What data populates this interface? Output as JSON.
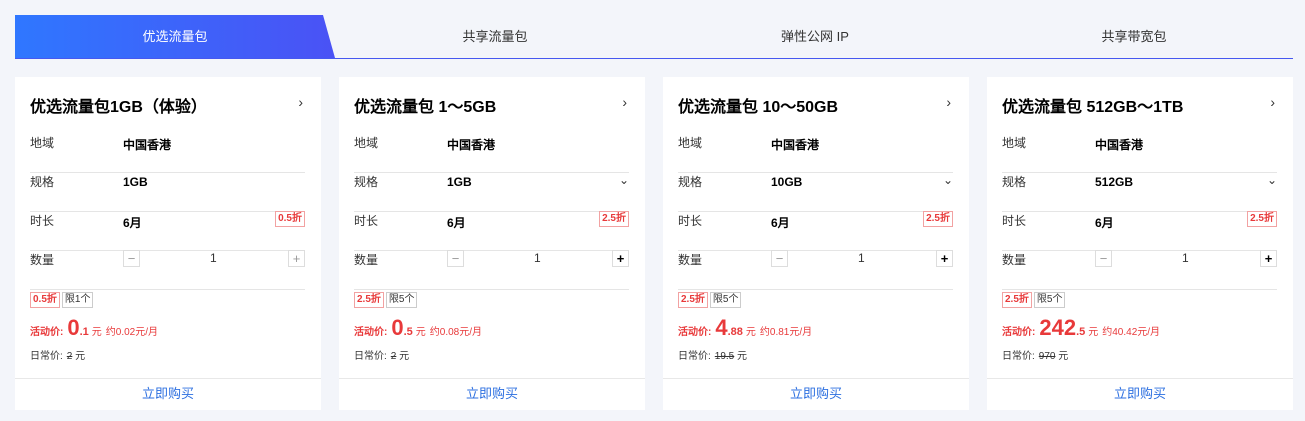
{
  "tabs": [
    {
      "label": "优选流量包",
      "active": true
    },
    {
      "label": "共享流量包",
      "active": false
    },
    {
      "label": "弹性公网 IP",
      "active": false
    },
    {
      "label": "共享带宽包",
      "active": false
    }
  ],
  "colors": {
    "accent": "#2f77ff",
    "accent_end": "#4a52f5",
    "price": "#e8393a",
    "link": "#2c6fe0"
  },
  "field_labels": {
    "region": "地域",
    "spec": "规格",
    "duration": "时长",
    "quantity": "数量"
  },
  "promo_label": "活动价:",
  "regular_label": "日常价:",
  "buy_label": "立即购买",
  "cards": [
    {
      "title": "优选流量包1GB（体验）",
      "region": "中国香港",
      "spec": "1GB",
      "duration": "6月",
      "duration_badge": "0.5折",
      "quantity": "1",
      "discount_tag": "0.5折",
      "limit_tag": "限1个",
      "promo_int": "0",
      "promo_dec": ".1",
      "promo_unit": "元",
      "promo_monthly": "约0.02元/月",
      "regular_price": "2",
      "regular_unit": "元"
    },
    {
      "title": "优选流量包 1～5GB",
      "region": "中国香港",
      "spec": "1GB",
      "duration": "6月",
      "duration_badge": "2.5折",
      "quantity": "1",
      "discount_tag": "2.5折",
      "limit_tag": "限5个",
      "promo_int": "0",
      "promo_dec": ".5",
      "promo_unit": "元",
      "promo_monthly": "约0.08元/月",
      "regular_price": "2",
      "regular_unit": "元"
    },
    {
      "title": "优选流量包 10～50GB",
      "region": "中国香港",
      "spec": "10GB",
      "duration": "6月",
      "duration_badge": "2.5折",
      "quantity": "1",
      "discount_tag": "2.5折",
      "limit_tag": "限5个",
      "promo_int": "4",
      "promo_dec": ".88",
      "promo_unit": "元",
      "promo_monthly": "约0.81元/月",
      "regular_price": "19.5",
      "regular_unit": "元"
    },
    {
      "title": "优选流量包 512GB～1TB",
      "region": "中国香港",
      "spec": "512GB",
      "duration": "6月",
      "duration_badge": "2.5折",
      "quantity": "1",
      "discount_tag": "2.5折",
      "limit_tag": "限5个",
      "promo_int": "242",
      "promo_dec": ".5",
      "promo_unit": "元",
      "promo_monthly": "约40.42元/月",
      "regular_price": "970",
      "regular_unit": "元"
    }
  ]
}
